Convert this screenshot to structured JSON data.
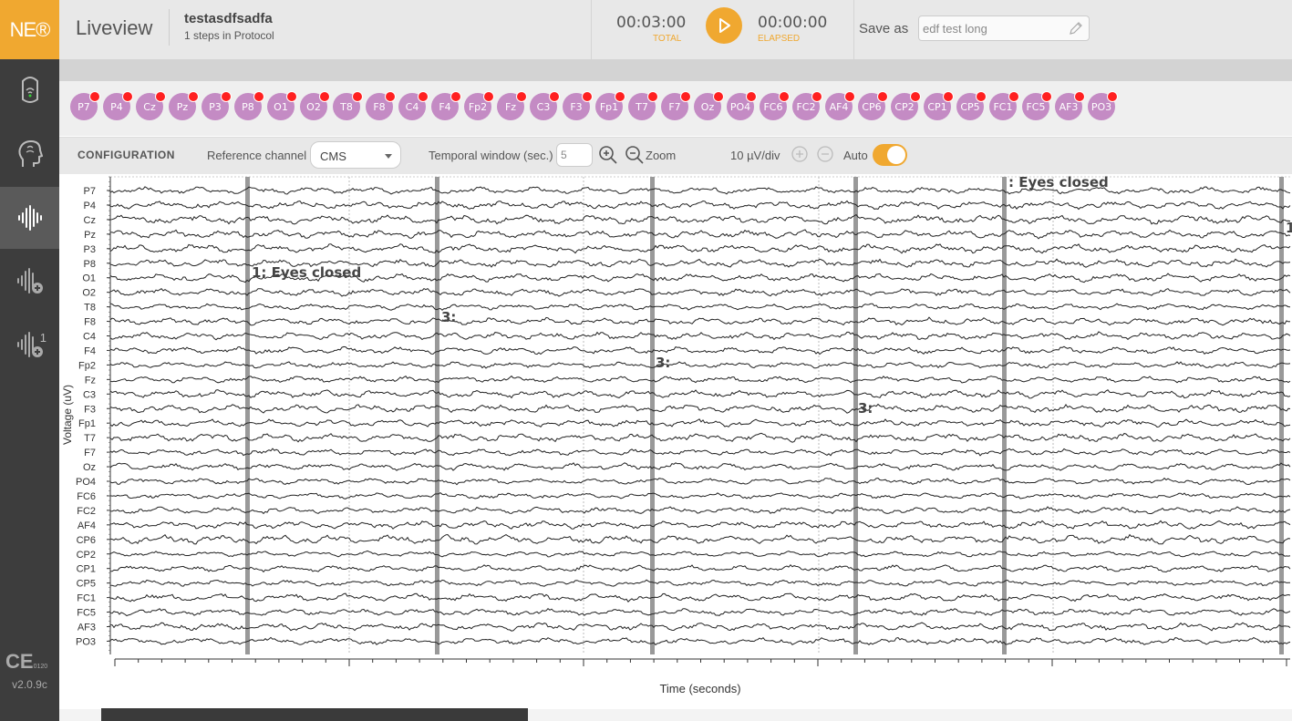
{
  "app": {
    "logo": "NE®",
    "title": "Liveview",
    "version": "v2.0.9c",
    "ce_mark": "CE",
    "ce_number": "0120"
  },
  "sidebar": {
    "items": [
      {
        "name": "device",
        "icon": "headset-signal-icon"
      },
      {
        "name": "head",
        "icon": "head-icon"
      },
      {
        "name": "liveview",
        "icon": "waveform-icon",
        "active": true
      },
      {
        "name": "add-protocol",
        "icon": "waveform-add-icon"
      },
      {
        "name": "add-protocol-2",
        "icon": "waveform-add-icon",
        "badge": "1"
      }
    ]
  },
  "protocol": {
    "name": "testasdfsadfa",
    "steps": "1 steps in Protocol"
  },
  "timer": {
    "total": "00:03:00",
    "total_label": "TOTAL",
    "elapsed": "00:00:00",
    "elapsed_label": "ELAPSED"
  },
  "save": {
    "label": "Save as",
    "value": "edf test long"
  },
  "channels": [
    "P7",
    "P4",
    "Cz",
    "Pz",
    "P3",
    "P8",
    "O1",
    "O2",
    "T8",
    "F8",
    "C4",
    "F4",
    "Fp2",
    "Fz",
    "C3",
    "F3",
    "Fp1",
    "T7",
    "F7",
    "Oz",
    "PO4",
    "FC6",
    "FC2",
    "AF4",
    "CP6",
    "CP2",
    "CP1",
    "CP5",
    "FC1",
    "FC5",
    "AF3",
    "PO3"
  ],
  "config": {
    "title": "CONFIGURATION",
    "ref_label": "Reference channel",
    "ref_value": "CMS",
    "tw_label": "Temporal window (sec.)",
    "tw_value": "5",
    "zoom_label": "Zoom",
    "scale": "10 µV/div",
    "auto_label": "Auto",
    "auto_on": true
  },
  "chart": {
    "ylabel": "Voltage (uV)",
    "xlabel": "Time (seconds)",
    "annotations": [
      {
        "text": "1: Eyes closed"
      },
      {
        "text": "3:"
      },
      {
        "text": "3:"
      },
      {
        "text": "3:"
      },
      {
        "text": ": Eyes closed"
      },
      {
        "text": "1"
      }
    ]
  },
  "colors": {
    "accent": "#f0a830",
    "sidebar": "#3d3d3d",
    "chip": "#c48bc4",
    "chip_dot": "#ff2020"
  }
}
